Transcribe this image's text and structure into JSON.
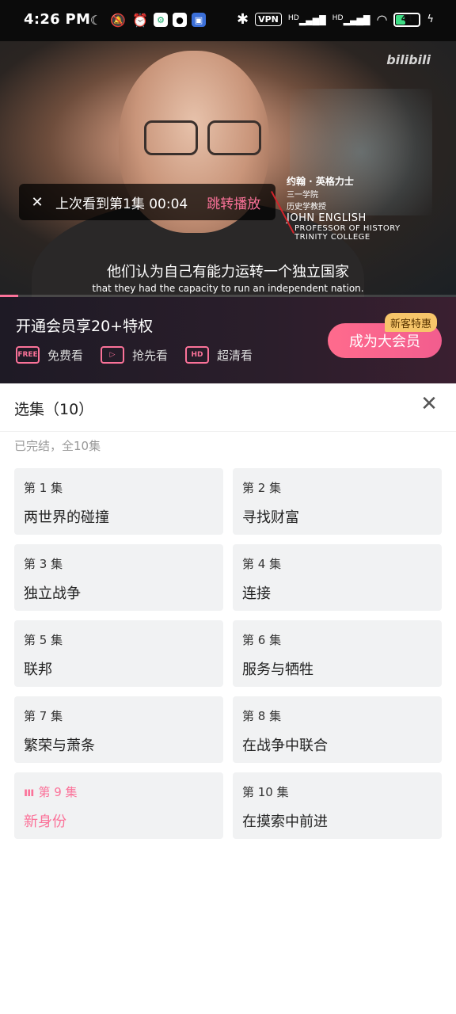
{
  "status_bar": {
    "time": "4:26 PM",
    "left_icons": [
      "moon-icon",
      "mute-icon",
      "alarm-icon",
      "settings-app-icon",
      "qq-icon",
      "app-icon"
    ],
    "right_icons": [
      "bluetooth-icon",
      "vpn-icon",
      "hd-signal-icon",
      "hd-signal-icon",
      "wifi-icon",
      "battery-icon",
      "charging-icon"
    ],
    "vpn_label": "VPN",
    "hd_label": "HD",
    "battery_level": "41"
  },
  "video": {
    "watermark": "bilibili",
    "resume_toast": {
      "text": "上次看到第1集 00:04",
      "action": "跳转播放"
    },
    "name_card": {
      "cn_name": "约翰 · 英格力士",
      "cn_line2": "三一学院",
      "cn_line3": "历史学教授",
      "en_name": "JOHN ENGLISH",
      "en_line2": "PROFESSOR OF HISTORY",
      "en_line3": "TRINITY COLLEGE"
    },
    "subtitle_cn": "他们认为自己有能力运转一个独立国家",
    "subtitle_en": "that they had the capacity to run an independent nation.",
    "progress_fraction": 0.04
  },
  "vip_banner": {
    "title": "开通会员享20+特权",
    "perks": [
      {
        "icon": "free-icon",
        "icon_text": "FREE",
        "label": "免费看"
      },
      {
        "icon": "early-access-icon",
        "icon_text": "▷",
        "label": "抢先看"
      },
      {
        "icon": "hd-icon",
        "icon_text": "HD",
        "label": "超清看"
      }
    ],
    "badge": "新客特惠",
    "button": "成为大会员",
    "accent": "#fb7299"
  },
  "episodes": {
    "title": "选集（10）",
    "status": "已完结，全10集",
    "active_index": 8,
    "items": [
      {
        "num": "第 1 集",
        "name": "两世界的碰撞"
      },
      {
        "num": "第 2 集",
        "name": "寻找财富"
      },
      {
        "num": "第 3 集",
        "name": "独立战争"
      },
      {
        "num": "第 4 集",
        "name": "连接"
      },
      {
        "num": "第 5 集",
        "name": "联邦"
      },
      {
        "num": "第 6 集",
        "name": "服务与牺牲"
      },
      {
        "num": "第 7 集",
        "name": "繁荣与萧条"
      },
      {
        "num": "第 8 集",
        "name": "在战争中联合"
      },
      {
        "num": "第 9 集",
        "name": "新身份"
      },
      {
        "num": "第 10 集",
        "name": "在摸索中前进"
      }
    ]
  }
}
